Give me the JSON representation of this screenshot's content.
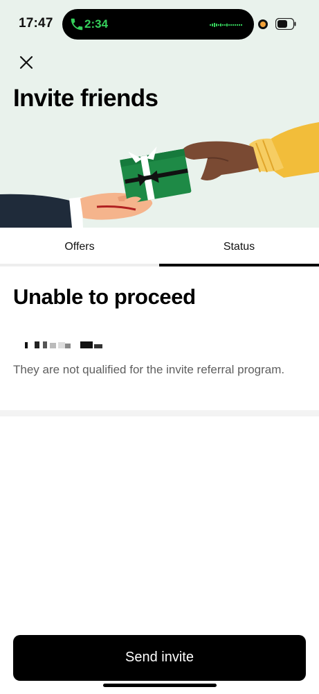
{
  "status_bar": {
    "time": "17:47",
    "call_duration": "2:34",
    "call_color": "#35d05b",
    "privacy_dot_color": "#f2a23a",
    "icons": [
      "phone-icon",
      "waveform-icon",
      "camera-indicator-icon",
      "battery-icon"
    ]
  },
  "header": {
    "close_icon": "close-icon",
    "title": "Invite friends",
    "background": "#e9f2ec",
    "illustration": "gift-handoff-illustration"
  },
  "tabs": [
    {
      "label": "Offers",
      "selected": false
    },
    {
      "label": "Status",
      "selected": true
    }
  ],
  "status": {
    "title": "Unable to proceed",
    "description": "They are not qualified for the invite referral program."
  },
  "footer": {
    "send_label": "Send invite",
    "button_color": "#000000"
  }
}
